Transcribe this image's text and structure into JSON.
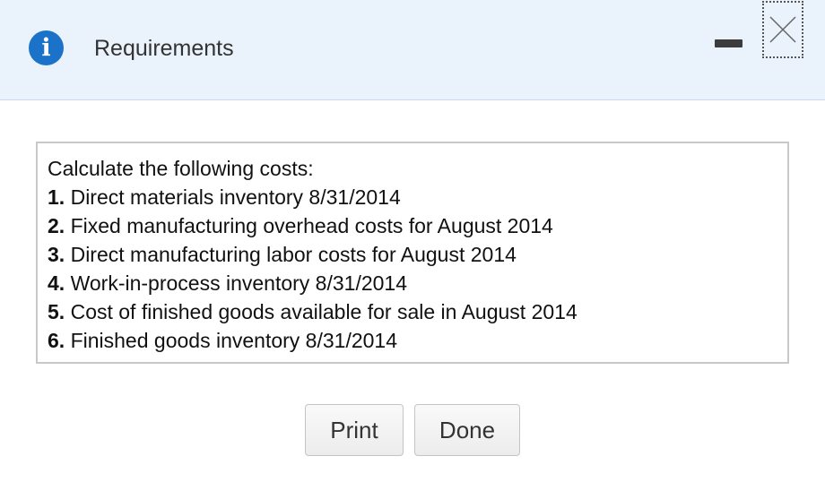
{
  "dialog": {
    "title": "Requirements",
    "icon": "info-icon",
    "accent_color": "#1a73c8"
  },
  "requirements": {
    "intro": "Calculate the following costs:",
    "items": [
      {
        "number": "1.",
        "text": "Direct materials inventory 8/31/2014"
      },
      {
        "number": "2.",
        "text": "Fixed manufacturing overhead costs for August 2014"
      },
      {
        "number": "3.",
        "text": "Direct manufacturing labor costs for August 2014"
      },
      {
        "number": "4.",
        "text": "Work-in-process inventory 8/31/2014"
      },
      {
        "number": "5.",
        "text": "Cost of finished goods available for sale in August 2014"
      },
      {
        "number": "6.",
        "text": "Finished goods inventory 8/31/2014"
      }
    ]
  },
  "buttons": {
    "print_label": "Print",
    "done_label": "Done"
  }
}
